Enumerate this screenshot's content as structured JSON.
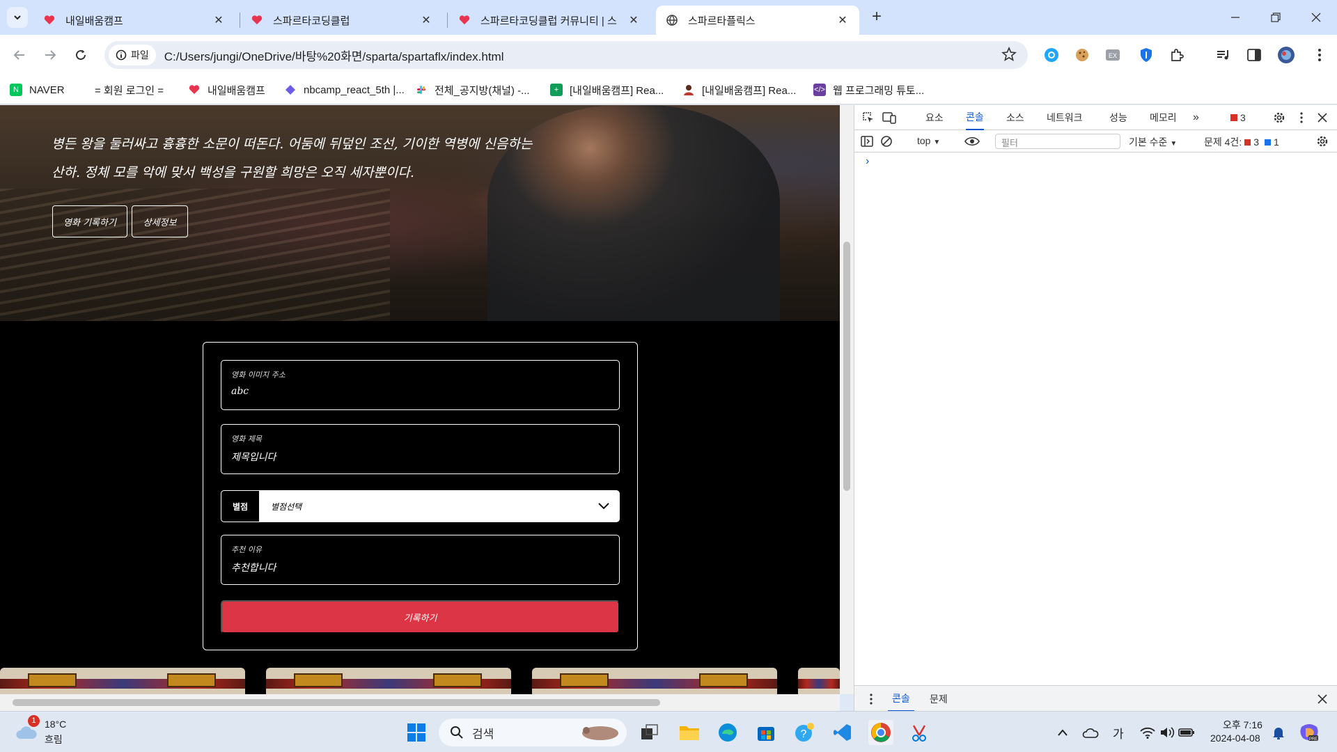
{
  "browser": {
    "tabs": [
      {
        "title": "내일배움캠프",
        "active": false
      },
      {
        "title": "스파르타코딩클럽",
        "active": false
      },
      {
        "title": "스파르타코딩클럽 커뮤니티 | 스",
        "active": false
      },
      {
        "title": "스파르타플릭스",
        "active": true
      }
    ],
    "chip_label": "파일",
    "url": "C:/Users/jungi/OneDrive/바탕%20화면/sparta/spartaflx/index.html",
    "bookmarks": [
      "NAVER",
      "= 회원 로그인 =",
      "내일배움캠프",
      "nbcamp_react_5th |...",
      "전체_공지방(채널) -...",
      "[내일배움캠프] Rea...",
      "[내일배움캠프] Rea...",
      "웹 프로그래밍 튜토..."
    ]
  },
  "hero": {
    "line1": "병든 왕을 둘러싸고 흉흉한 소문이 떠돈다. 어둠에 뒤덮인 조선, 기이한 역병에 신음하는",
    "line2": "산하. 정체 모를 악에 맞서 백성을 구원할 희망은 오직 세자뿐이다.",
    "btn_record": "영화 기록하기",
    "btn_detail": "상세정보"
  },
  "form": {
    "image_label": "영화 이미지 주소",
    "image_value": "abc",
    "title_label": "영화 제목",
    "title_value": "제목입니다",
    "rating_label": "별점",
    "rating_value": "별점선택",
    "reason_label": "추천 이유",
    "reason_value": "추천합니다",
    "submit_label": "기록하기"
  },
  "devtools": {
    "tabs": [
      "요소",
      "콘솔",
      "소스",
      "네트워크",
      "성능",
      "메모리"
    ],
    "active_tab": "콘솔",
    "error_count": "3",
    "context": "top",
    "filter_placeholder": "필터",
    "level": "기본 수준",
    "issues_label": "문제 4건:",
    "issues_errors": "3",
    "issues_info": "1",
    "drawer_tabs": [
      "콘솔",
      "문제"
    ]
  },
  "taskbar": {
    "weather_temp": "18°C",
    "weather_desc": "흐림",
    "weather_badge": "1",
    "search_label": "검색",
    "ime": "가",
    "time": "오후 7:16",
    "date": "2024-04-08"
  },
  "colors": {
    "accent": "#0b57d0",
    "submit": "#dc3545",
    "tabstrip": "#d3e3fd"
  }
}
